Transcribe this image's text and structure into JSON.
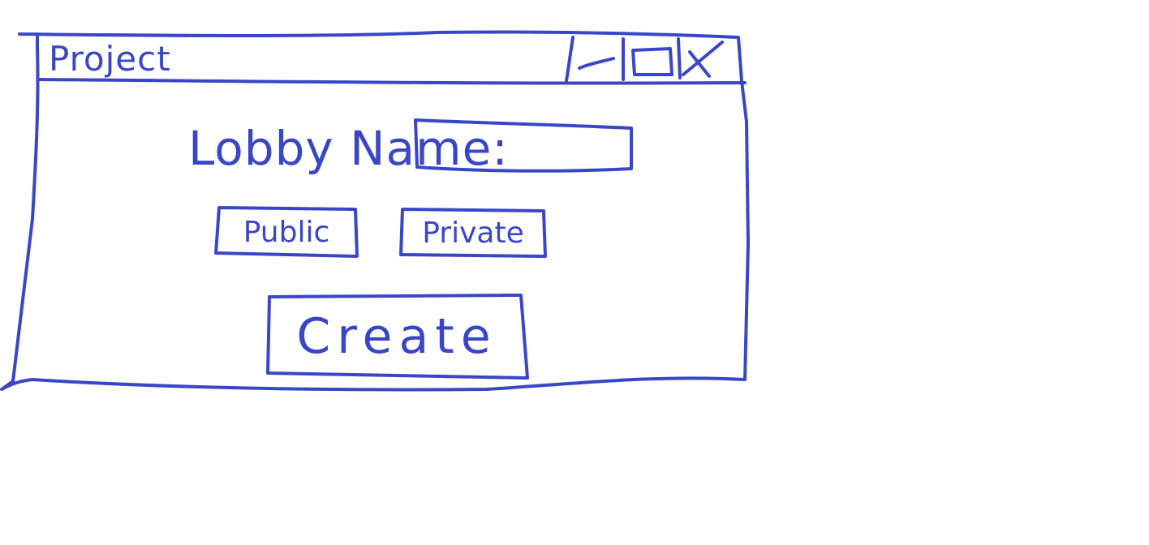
{
  "window": {
    "title": "Project"
  },
  "form": {
    "lobby_name_label": "Lobby Name:",
    "lobby_name_value": "",
    "public_label": "Public",
    "private_label": "Private",
    "create_label": "Create"
  },
  "colors": {
    "ink": "#3a46c8",
    "background": "#ffffff"
  },
  "icons": {
    "minimize": "minimize-icon",
    "maximize": "maximize-icon",
    "close": "close-icon"
  }
}
